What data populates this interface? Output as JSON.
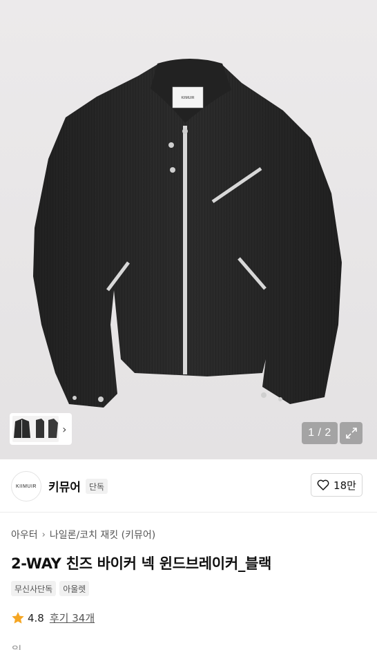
{
  "gallery": {
    "pager_text": "1 / 2",
    "thumbnail_chevron": "›",
    "expand_icon": "expand-icon"
  },
  "brand": {
    "logo_text": "KIIMUIR",
    "name": "키뮤어",
    "tag": "단독",
    "like_count": "18만"
  },
  "product": {
    "breadcrumb": [
      "아우터",
      "나일론/코치 재킷 (키뮤어)"
    ],
    "title": "2-WAY 친즈 바이커 넥 윈드브레이커_블랙",
    "badges": [
      "무신사단독",
      "아울렛"
    ],
    "rating": "4.8",
    "review_text": "후기 34개",
    "price_peek": "원"
  },
  "colors": {
    "star": "#f5a623",
    "jacket": "#2b2b2b",
    "zipper": "#d8d8d8"
  }
}
